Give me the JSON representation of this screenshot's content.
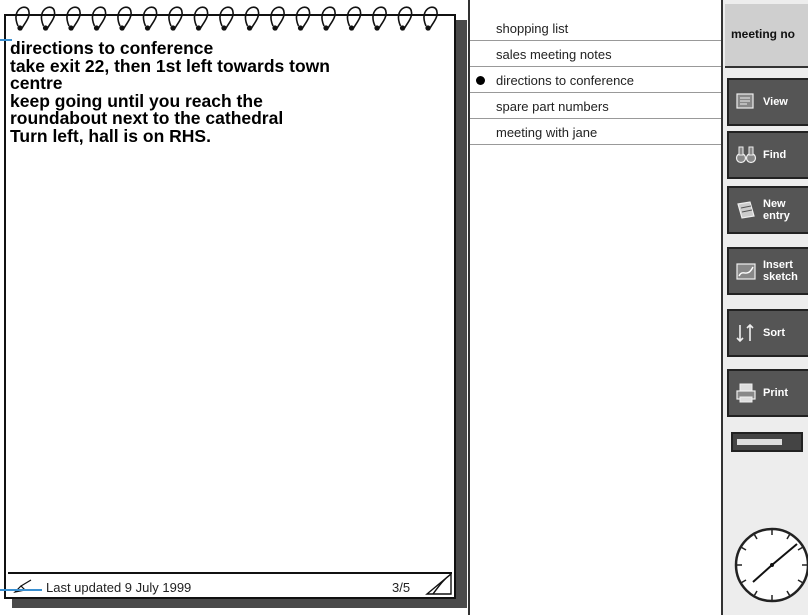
{
  "note": {
    "lines": [
      "directions to conference",
      "take exit 22, then 1st left towards town",
      "centre",
      "keep going until you reach the",
      "roundabout next to the cathedral",
      "Turn left, hall is on RHS."
    ],
    "footer_updated": "Last updated 9 July 1999",
    "page_indicator": "3/5"
  },
  "entries": [
    {
      "label": "shopping list",
      "selected": false
    },
    {
      "label": "sales meeting notes",
      "selected": false
    },
    {
      "label": "directions to conference",
      "selected": true
    },
    {
      "label": "spare part numbers",
      "selected": false
    },
    {
      "label": "meeting with jane",
      "selected": false
    }
  ],
  "toolbar": {
    "title": "meeting no",
    "buttons": [
      {
        "label": "View",
        "icon": "view-icon"
      },
      {
        "label": "Find",
        "icon": "binoculars-icon"
      },
      {
        "label": "New\nentry",
        "icon": "new-entry-icon"
      },
      {
        "label": "Insert\nsketch",
        "icon": "sketch-icon"
      },
      {
        "label": "Sort",
        "icon": "sort-icon"
      },
      {
        "label": "Print",
        "icon": "printer-icon"
      }
    ],
    "battery_level": 0.75
  },
  "colors": {
    "callout": "#3a8fd0",
    "button_bg": "#555555"
  }
}
